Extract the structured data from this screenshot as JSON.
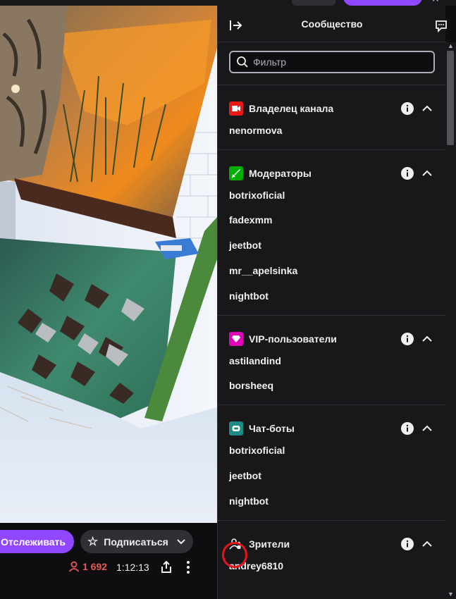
{
  "top_close": "✕",
  "below_video": {
    "follow_label": "Отслеживать",
    "subscribe_label": "Подписаться",
    "viewer_count": "1 692",
    "uptime": "1:12:13"
  },
  "panel": {
    "title": "Сообщество",
    "filter_placeholder": "Фильтр",
    "sections": [
      {
        "title": "Владелец канала",
        "badge_color": "#e91916",
        "users": [
          "nenormova"
        ]
      },
      {
        "title": "Модераторы",
        "badge_color": "#00ad03",
        "users": [
          "botrixoficial",
          "fadexmm",
          "jeetbot",
          "mr__apelsinka",
          "nightbot"
        ]
      },
      {
        "title": "VIP-пользователи",
        "badge_color": "#e005b9",
        "users": [
          "astilandind",
          "borsheeq"
        ]
      },
      {
        "title": "Чат-боты",
        "badge_color": "#1e8a84",
        "users": [
          "botrixoficial",
          "jeetbot",
          "nightbot"
        ]
      },
      {
        "title": "Зрители",
        "badge_color": "#18181b",
        "users": [
          "andrey6810"
        ]
      }
    ]
  },
  "colors": {
    "accent": "#9147ff",
    "viewer_red": "#eb5a5a",
    "panel_bg": "#18181b"
  }
}
